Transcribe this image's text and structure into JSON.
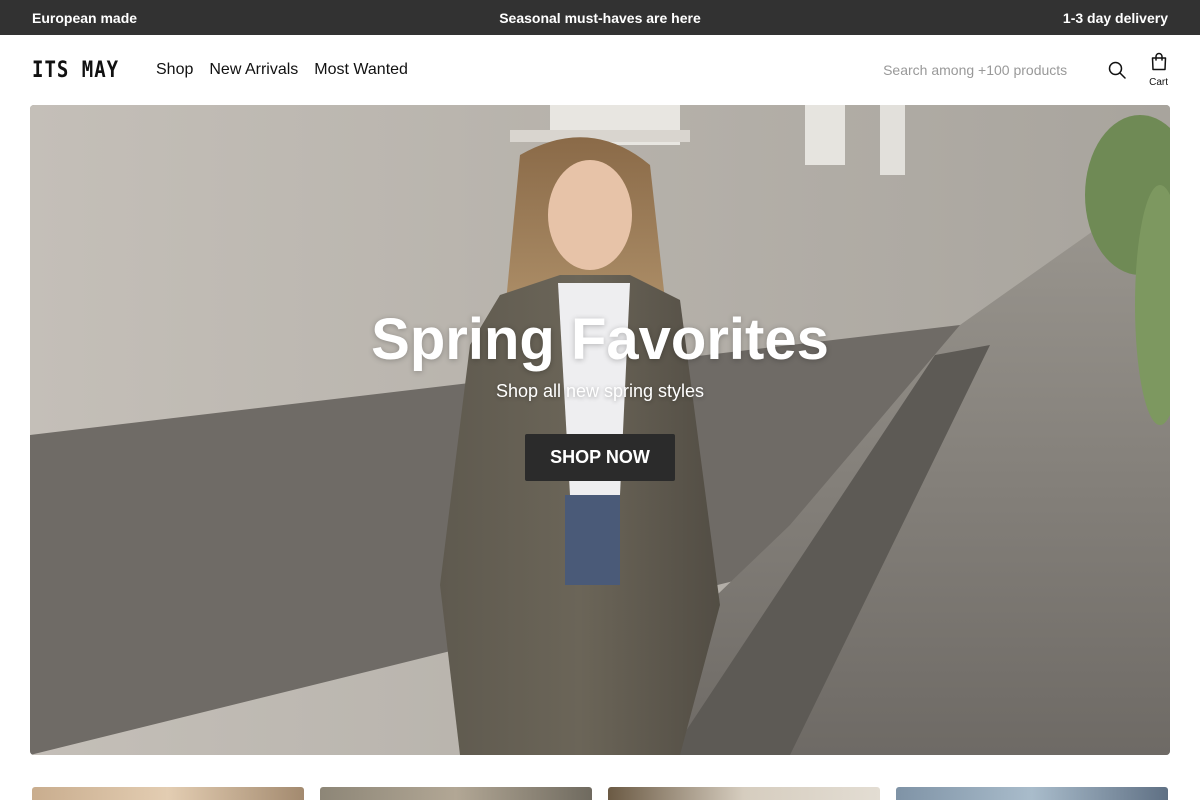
{
  "announcement": {
    "left": "European made",
    "center": "Seasonal must-haves are here",
    "right": "1-3 day delivery"
  },
  "header": {
    "logo": "ITS MAY",
    "nav": [
      "Shop",
      "New Arrivals",
      "Most Wanted"
    ],
    "search": {
      "placeholder": "Search among +100 products",
      "value": ""
    },
    "cart_label": "Cart"
  },
  "hero": {
    "title": "Spring Favorites",
    "subtitle": "Shop all new spring styles",
    "cta": "SHOP NOW"
  },
  "icons": {
    "search": "search-icon",
    "cart": "shopping-bag-icon"
  },
  "colors": {
    "topbar_bg": "#323232",
    "cta_bg": "#2b2b2b",
    "text": "#111111"
  }
}
